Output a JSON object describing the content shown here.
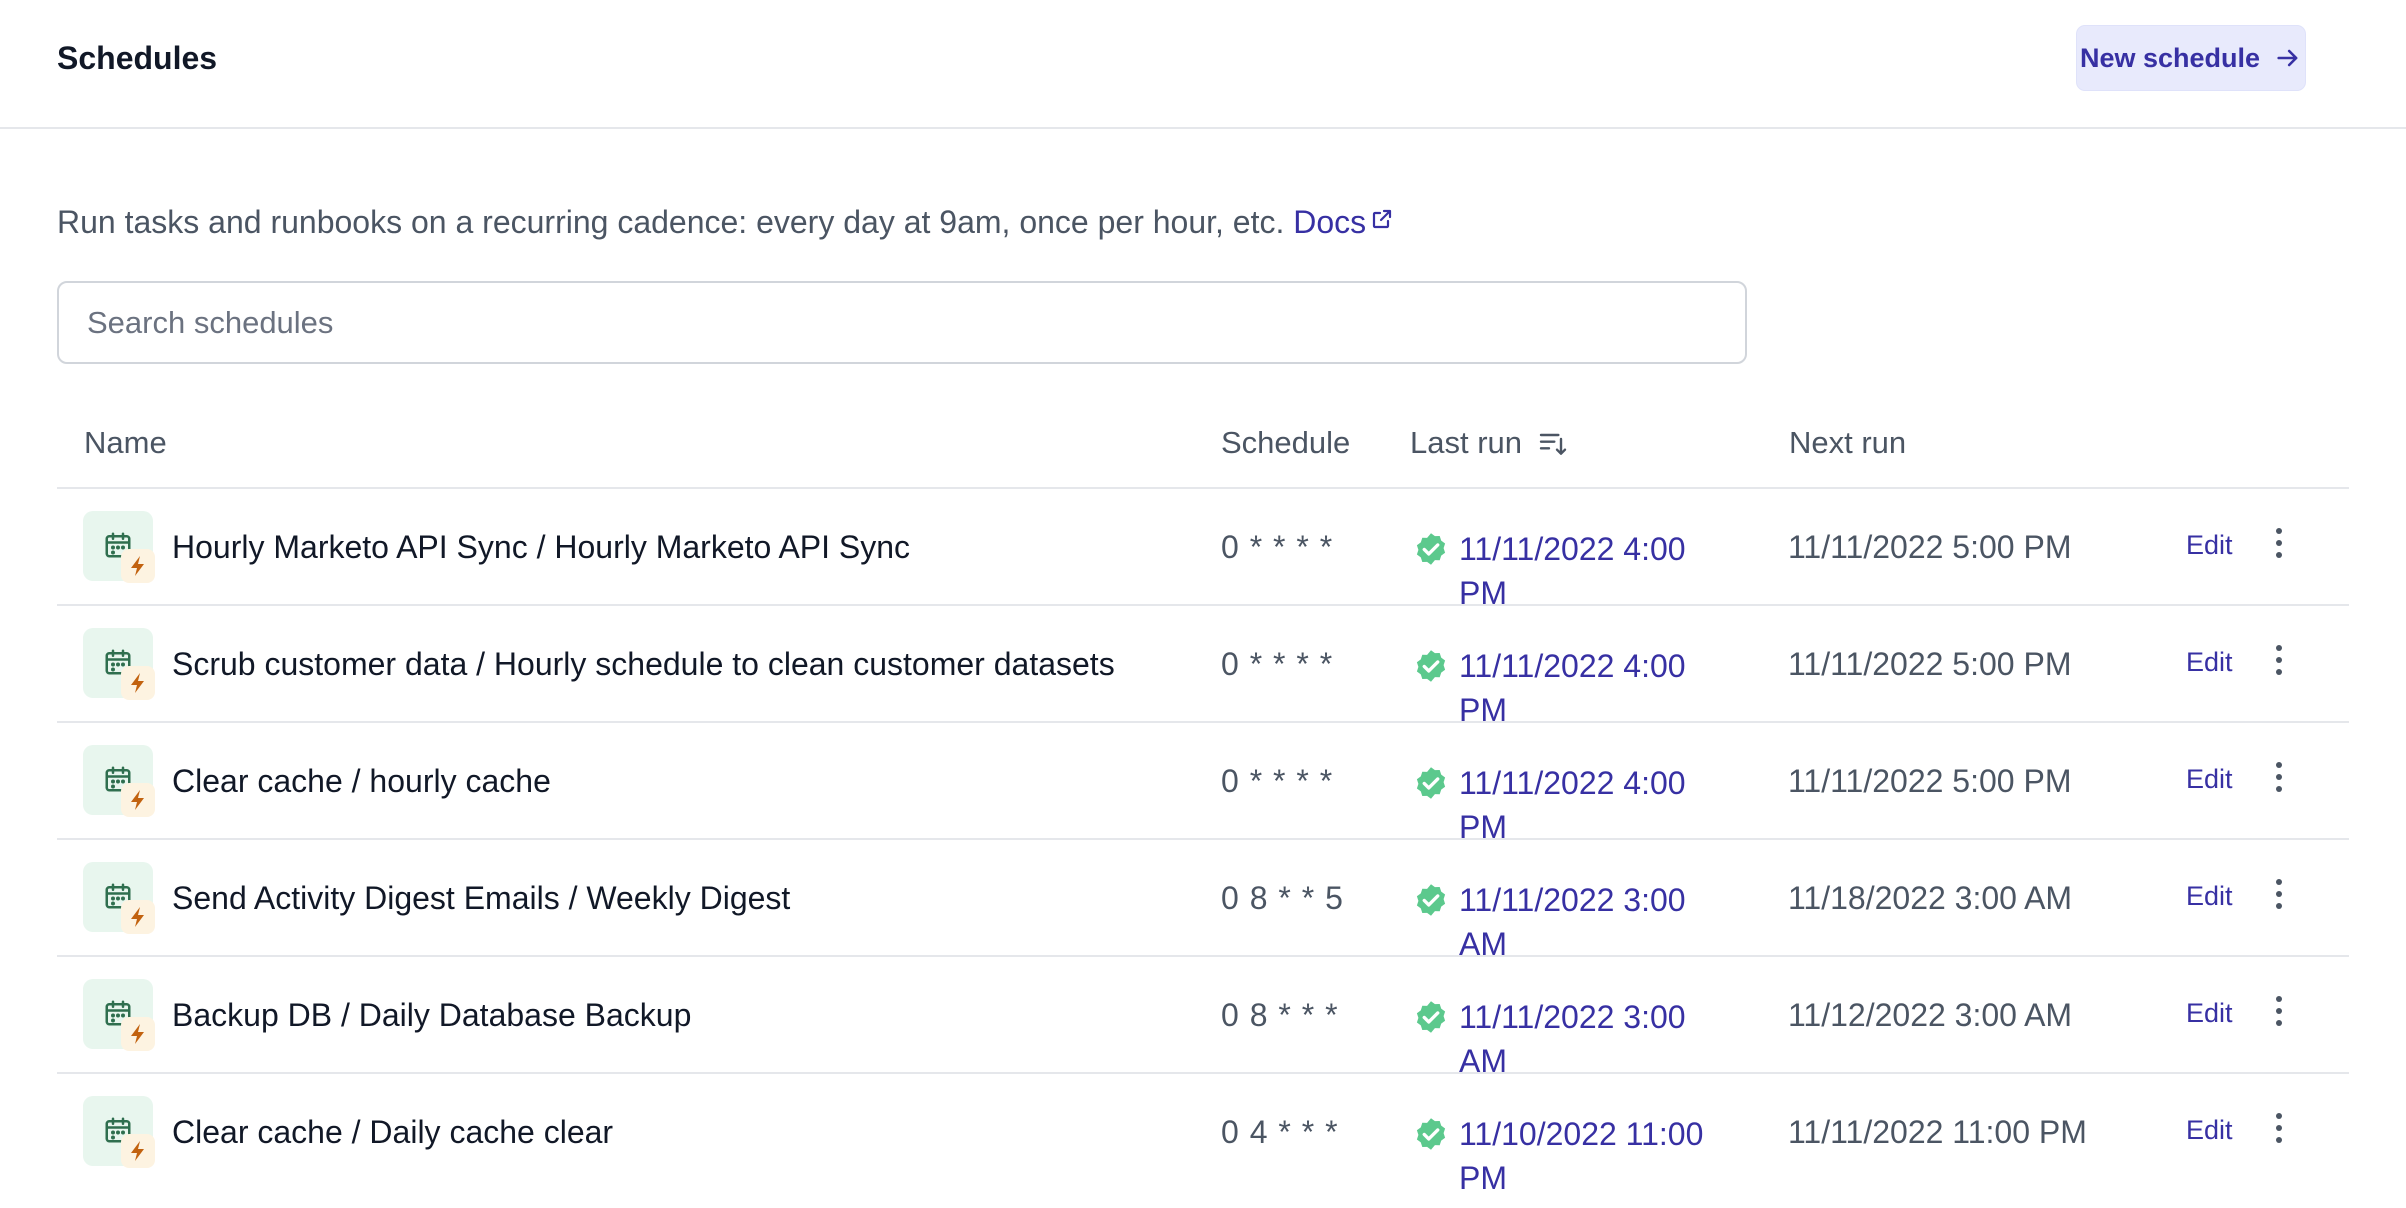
{
  "header": {
    "title": "Schedules",
    "new_button_label": "New schedule"
  },
  "intro": {
    "description": "Run tasks and runbooks on a recurring cadence: every day at 9am, once per hour, etc.",
    "docs_label": "Docs"
  },
  "search": {
    "placeholder": "Search schedules",
    "value": ""
  },
  "table": {
    "columns": {
      "name": "Name",
      "schedule": "Schedule",
      "last_run": "Last run",
      "next_run": "Next run"
    },
    "rows": [
      {
        "name": "Hourly Marketo API Sync / Hourly Marketo API Sync",
        "schedule": "0 * * * *",
        "last_run": "11/11/2022 4:00 PM",
        "next_run": "11/11/2022 5:00 PM",
        "edit_label": "Edit"
      },
      {
        "name": "Scrub customer data / Hourly schedule to clean customer datasets",
        "schedule": "0 * * * *",
        "last_run": "11/11/2022 4:00 PM",
        "next_run": "11/11/2022 5:00 PM",
        "edit_label": "Edit"
      },
      {
        "name": "Clear cache / hourly cache",
        "schedule": "0 * * * *",
        "last_run": "11/11/2022 4:00 PM",
        "next_run": "11/11/2022 5:00 PM",
        "edit_label": "Edit"
      },
      {
        "name": "Send Activity Digest Emails / Weekly Digest",
        "schedule": "0 8 * * 5",
        "last_run": "11/11/2022 3:00 AM",
        "next_run": "11/18/2022 3:00 AM",
        "edit_label": "Edit"
      },
      {
        "name": "Backup DB / Daily Database Backup",
        "schedule": "0 8 * * *",
        "last_run": "11/11/2022 3:00 AM",
        "next_run": "11/12/2022 3:00 AM",
        "edit_label": "Edit"
      },
      {
        "name": "Clear cache / Daily cache clear",
        "schedule": "0 4 * * *",
        "last_run": "11/10/2022 11:00 PM",
        "next_run": "11/11/2022 11:00 PM",
        "edit_label": "Edit"
      }
    ]
  },
  "icons": {
    "row_icon": "calendar-icon",
    "row_badge": "lightning-bolt-icon",
    "status": "check-badge-icon",
    "more": "more-vertical-icon",
    "sort": "sort-descending-icon",
    "external": "external-link-icon",
    "arrow": "arrow-right-icon"
  },
  "colors": {
    "accent": "#3730a3",
    "accent_bg": "#e8eafc",
    "success": "#5cc98d",
    "row_icon_bg": "#e8f6ee",
    "row_icon_fg": "#2f6f4f",
    "bolt_bg": "#fdf3e1",
    "bolt_fg": "#c2620f"
  }
}
